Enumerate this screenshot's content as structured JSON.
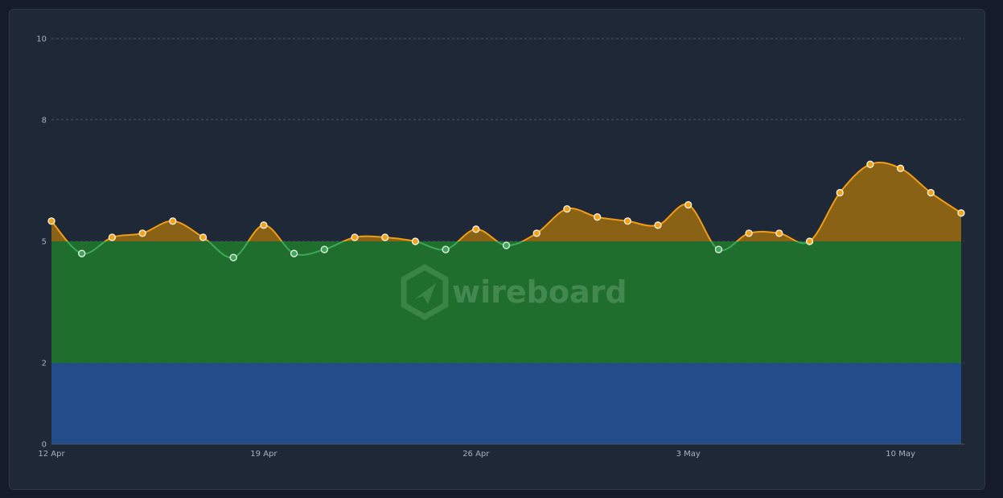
{
  "chart_data": {
    "type": "area",
    "x": [
      "12 Apr",
      "13 Apr",
      "14 Apr",
      "15 Apr",
      "16 Apr",
      "17 Apr",
      "18 Apr",
      "19 Apr",
      "20 Apr",
      "21 Apr",
      "22 Apr",
      "23 Apr",
      "24 Apr",
      "25 Apr",
      "26 Apr",
      "27 Apr",
      "28 Apr",
      "29 Apr",
      "30 Apr",
      "1 May",
      "2 May",
      "3 May",
      "4 May",
      "5 May",
      "6 May",
      "7 May",
      "8 May",
      "9 May",
      "10 May",
      "11 May",
      "12 May"
    ],
    "x_tick_labels": [
      "12 Apr",
      "19 Apr",
      "26 Apr",
      "3 May",
      "10 May"
    ],
    "y_ticks": [
      0,
      2,
      5,
      8,
      10
    ],
    "ylim": [
      0,
      10
    ],
    "grid": true,
    "series": [
      {
        "values": [
          2,
          2,
          2,
          2,
          2,
          2,
          2,
          2,
          2,
          2,
          2,
          2,
          2,
          2,
          2,
          2,
          2,
          2,
          2,
          2,
          2,
          2,
          2,
          2,
          2,
          2,
          2,
          2,
          2,
          2,
          2
        ]
      },
      {
        "values": [
          5,
          5,
          5,
          5,
          5,
          5,
          5,
          5,
          5,
          5,
          5,
          5,
          5,
          5,
          5,
          5,
          5,
          5,
          5,
          5,
          5,
          5,
          5,
          5,
          5,
          5,
          5,
          5,
          5,
          5,
          5
        ]
      },
      {
        "values": [
          5.5,
          4.7,
          5.1,
          5.2,
          5.5,
          5.1,
          4.6,
          5.4,
          4.7,
          4.8,
          5.1,
          5.1,
          5.0,
          4.8,
          5.3,
          4.9,
          5.2,
          5.8,
          5.6,
          5.5,
          5.4,
          5.9,
          4.8,
          5.2,
          5.2,
          5.0,
          6.2,
          6.9,
          6.8,
          6.2,
          5.7
        ]
      }
    ],
    "colors": {
      "band1": "#224d8a",
      "band2": "#1f6e2d",
      "band3_fill": "#8a6215",
      "line_above": "#f29d12",
      "line_below": "#3fa857",
      "marker_above": "#f2a31a",
      "marker_below": "#3fa857",
      "grid": "#4a5463",
      "tick_text": "#a8b0bc"
    }
  },
  "watermark": {
    "text": "wireboard",
    "icon": "wireboard-logo-icon"
  }
}
